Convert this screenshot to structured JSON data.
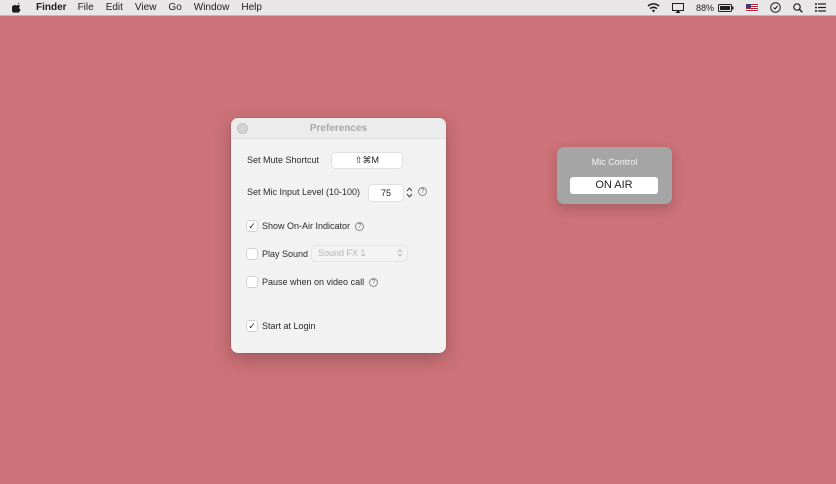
{
  "menubar": {
    "app_name": "Finder",
    "items": [
      "File",
      "Edit",
      "View",
      "Go",
      "Window",
      "Help"
    ],
    "battery": "88%"
  },
  "preferences": {
    "title": "Preferences",
    "mute_shortcut_label": "Set Mute Shortcut",
    "mute_shortcut_value": "⇧⌘M",
    "mic_level_label": "Set Mic Input Level (10-100)",
    "mic_level_value": "75",
    "show_onair_label": "Show On-Air Indicator",
    "show_onair_checked": true,
    "play_sound_label": "Play Sound",
    "play_sound_checked": false,
    "sound_select_value": "Sound FX 1",
    "pause_video_label": "Pause when on video call",
    "pause_video_checked": false,
    "start_login_label": "Start at Login",
    "start_login_checked": true,
    "help_glyph": "?"
  },
  "mic_control": {
    "title": "Mic Control",
    "status_button": "ON AIR"
  },
  "colors": {
    "desktop": "#cc7278",
    "window_bg": "#f2f2f2",
    "mic_panel": "#a5a5a5"
  }
}
